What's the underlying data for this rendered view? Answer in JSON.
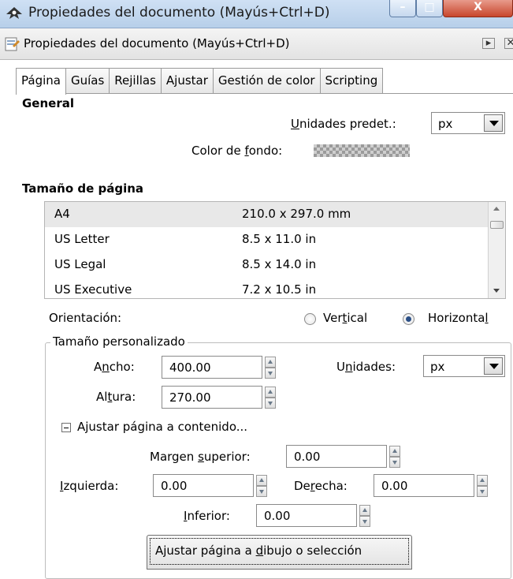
{
  "window": {
    "title": "Propiedades del documento (Mayús+Ctrl+D)",
    "controls": {
      "minimize": "–",
      "maximize": "□",
      "close": "X"
    }
  },
  "dock": {
    "title": "Propiedades del documento (Mayús+Ctrl+D)",
    "btn1": "▸",
    "btn2": "✕"
  },
  "tabs": [
    "Página",
    "Guías",
    "Rejillas",
    "Ajustar",
    "Gestión de color",
    "Scripting"
  ],
  "general": {
    "heading": "General",
    "units_label_pre": "",
    "units_label_u": "U",
    "units_label_post": "nidades predet.:",
    "units_value": "px",
    "bg_label_pre": "Color de ",
    "bg_label_u": "f",
    "bg_label_post": "ondo:"
  },
  "page_size": {
    "heading": "Tamaño de página",
    "rows": [
      {
        "name": "A4",
        "dim": "210.0 x 297.0 mm"
      },
      {
        "name": "US Letter",
        "dim": "8.5 x 11.0 in"
      },
      {
        "name": "US Legal",
        "dim": "8.5 x 14.0 in"
      },
      {
        "name": "US Executive",
        "dim": "7.2 x 10.5 in"
      }
    ]
  },
  "orientation": {
    "label": "Orientación:",
    "vertical_pre": "Ver",
    "vertical_u": "t",
    "vertical_post": "ical",
    "horizontal_pre": "Horizonta",
    "horizontal_u": "l",
    "horizontal_post": "",
    "selected": "Horizontal"
  },
  "custom": {
    "group_label": "Tamaño personalizado",
    "width_pre": "A",
    "width_u": "n",
    "width_post": "cho:",
    "width_value": "400.00",
    "height_pre": "Al",
    "height_u": "t",
    "height_post": "ura:",
    "height_value": "270.00",
    "units_pre": "U",
    "units_u": "n",
    "units_post": "idades:",
    "units_value": "px"
  },
  "fit": {
    "expander_label": "Ajustar página a contenido...",
    "top_pre": "Margen ",
    "top_u": "s",
    "top_post": "uperior:",
    "top_value": "0.00",
    "left_pre": "",
    "left_u": "I",
    "left_post": "zquierda:",
    "left_value": "0.00",
    "right_pre": "De",
    "right_u": "r",
    "right_post": "echa:",
    "right_value": "0.00",
    "bottom_pre": "",
    "bottom_u": "I",
    "bottom_post": "nferior:",
    "bottom_value": "0.00",
    "button_pre": "Ajustar página a ",
    "button_u": "d",
    "button_post": "ibujo o selección"
  }
}
